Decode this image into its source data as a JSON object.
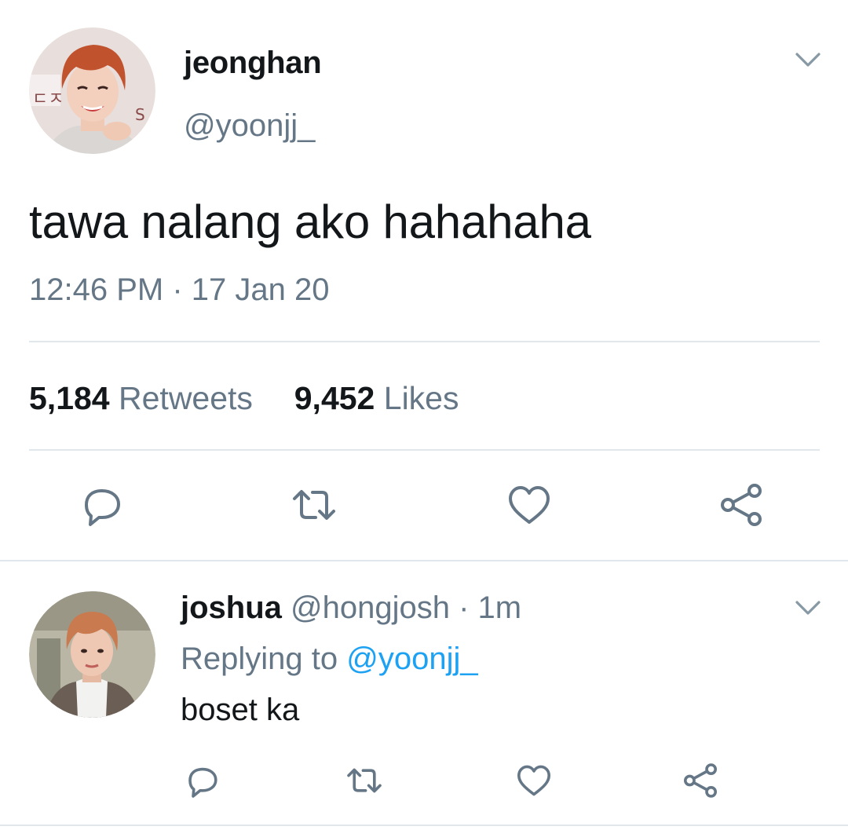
{
  "tweet": {
    "display_name": "jeonghan",
    "handle": "@yoonjj_",
    "text": "tawa nalang ako hahahaha",
    "timestamp": "12:46 PM · 17 Jan 20",
    "retweets_count": "5,184",
    "retweets_label": "Retweets",
    "likes_count": "9,452",
    "likes_label": "Likes"
  },
  "reply": {
    "display_name": "joshua",
    "handle": "@hongjosh",
    "time": "· 1m",
    "replying_prefix": "Replying to",
    "replying_to": "@yoonjj_",
    "text": "boset ka"
  },
  "icons": {
    "reply": "reply-bubble-icon",
    "retweet": "retweet-arrows-icon",
    "like": "heart-icon",
    "share": "share-nodes-icon",
    "menu": "chevron-down-icon"
  },
  "colors": {
    "text_primary": "#14171a",
    "text_secondary": "#657786",
    "link": "#1da1f2",
    "icon": "#657786",
    "divider": "#e1e8ed"
  }
}
